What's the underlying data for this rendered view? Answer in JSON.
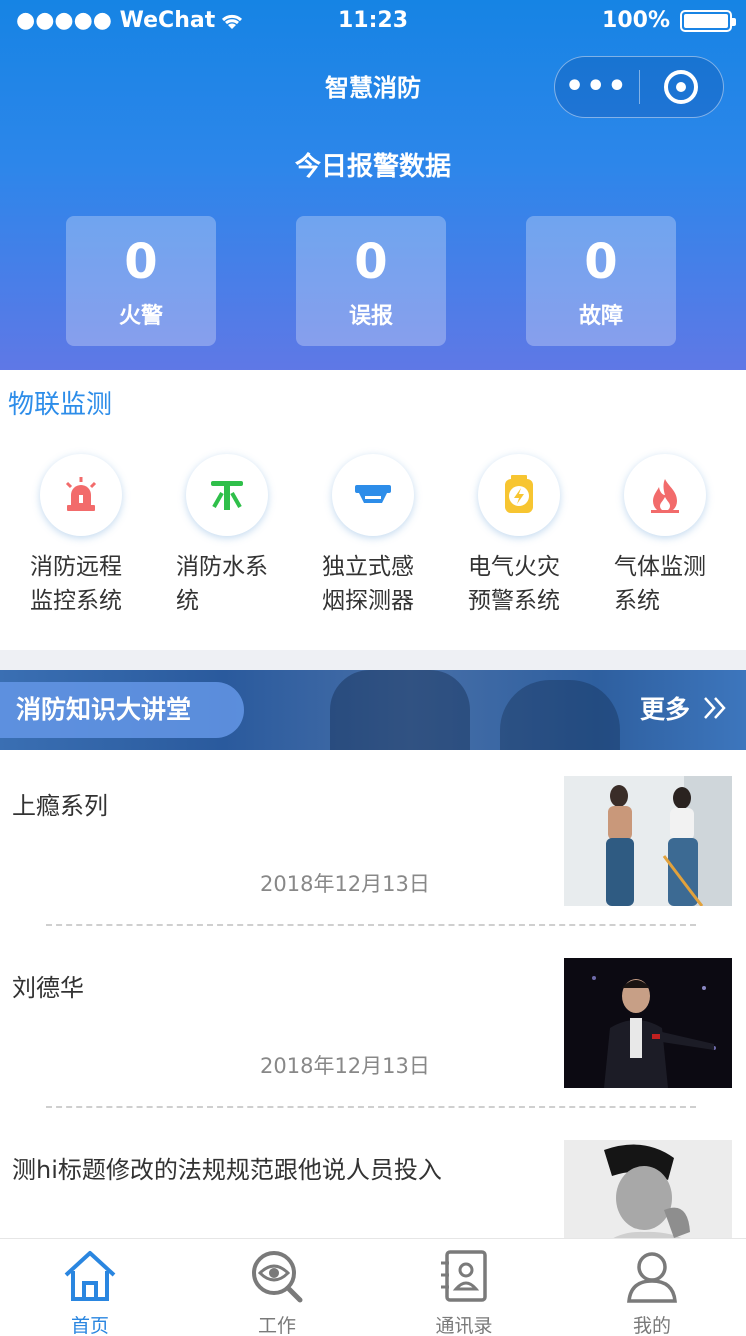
{
  "status_bar": {
    "carrier": "●●●●● WeChat",
    "time": "11:23",
    "battery": "100%"
  },
  "nav": {
    "title": "智慧消防"
  },
  "today_alarms": {
    "title": "今日报警数据",
    "stats": [
      {
        "value": "0",
        "label": "火警"
      },
      {
        "value": "0",
        "label": "误报"
      },
      {
        "value": "0",
        "label": "故障"
      }
    ]
  },
  "iot": {
    "title": "物联监测",
    "items": [
      {
        "label": "消防远程监控系统",
        "icon": "alarm-light-icon",
        "color": "#f26b6b"
      },
      {
        "label": "消防水系统",
        "icon": "hydrant-icon",
        "color": "#2fbf4a"
      },
      {
        "label": "独立式感烟探测器",
        "icon": "smoke-detector-icon",
        "color": "#2d8de9"
      },
      {
        "label": "电气火灾预警系统",
        "icon": "lightning-battery-icon",
        "color": "#f7c531"
      },
      {
        "label": "气体监测系统",
        "icon": "flame-icon",
        "color": "#f26b6b"
      }
    ]
  },
  "banner": {
    "title": "消防知识大讲堂",
    "more": "更多"
  },
  "news": [
    {
      "title": "上瘾系列",
      "date": "2018年12月13日"
    },
    {
      "title": "刘德华",
      "date": "2018年12月13日"
    },
    {
      "title": "测hi标题修改的法规规范跟他说人员投入",
      "date": ""
    }
  ],
  "tabbar": {
    "items": [
      {
        "label": "首页",
        "icon": "home-icon",
        "active": true
      },
      {
        "label": "工作",
        "icon": "eye-search-icon",
        "active": false
      },
      {
        "label": "通讯录",
        "icon": "contacts-book-icon",
        "active": false
      },
      {
        "label": "我的",
        "icon": "user-icon",
        "active": false
      }
    ],
    "active_color": "#2a86e0",
    "inactive_color": "#7a7a7a"
  }
}
